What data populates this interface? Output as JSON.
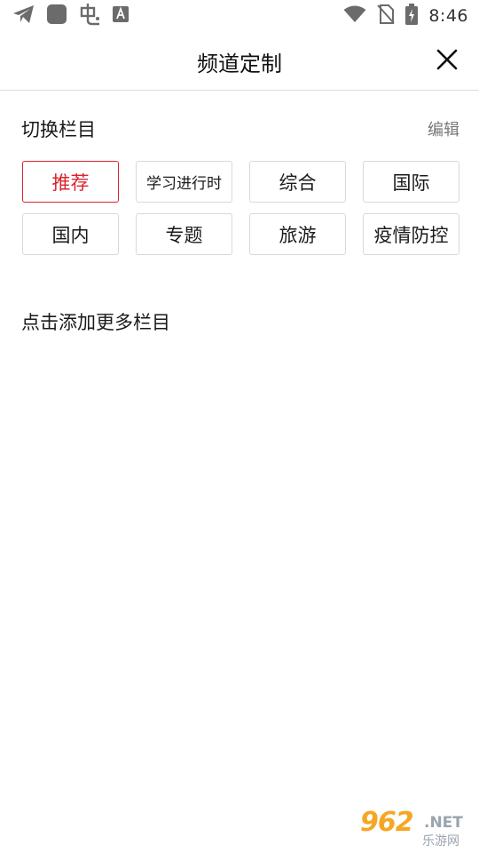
{
  "status_bar": {
    "time": "8:46",
    "icons": [
      "telegram-icon",
      "app-square-icon",
      "app-chong-icon",
      "text-a-icon",
      "wifi-icon",
      "no-sim-icon",
      "battery-charging-icon"
    ]
  },
  "header": {
    "title": "频道定制",
    "close_icon": "close-icon"
  },
  "switch_section": {
    "title": "切换栏目",
    "edit_label": "编辑"
  },
  "channels": [
    {
      "label": "推荐",
      "selected": true
    },
    {
      "label": "学习进行时",
      "selected": false
    },
    {
      "label": "综合",
      "selected": false
    },
    {
      "label": "国际",
      "selected": false
    },
    {
      "label": "国内",
      "selected": false
    },
    {
      "label": "专题",
      "selected": false
    },
    {
      "label": "旅游",
      "selected": false
    },
    {
      "label": "疫情防控",
      "selected": false
    }
  ],
  "more_section": {
    "title": "点击添加更多栏目"
  },
  "watermark": {
    "number": "962",
    "suffix": ".NET",
    "cn": "乐游网"
  },
  "colors": {
    "accent": "#d9232e",
    "border": "#d9d9d9",
    "watermark_orange": "#f5a623"
  }
}
